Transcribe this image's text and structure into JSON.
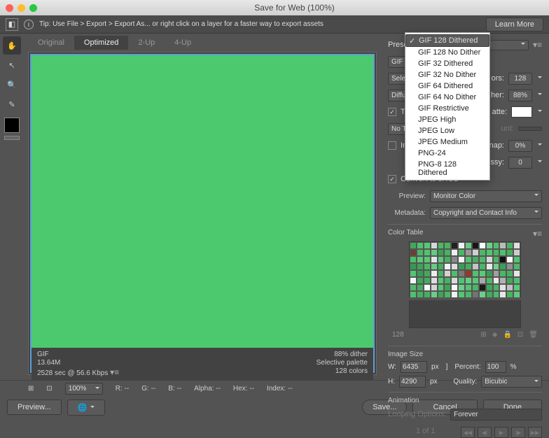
{
  "window": {
    "title": "Save for Web (100%)"
  },
  "tip": {
    "text": "Tip: Use File > Export > Export As...   or right click on a layer for a faster way to export assets",
    "learn": "Learn More"
  },
  "tabs": [
    "Original",
    "Optimized",
    "2-Up",
    "4-Up"
  ],
  "footerLeft": {
    "format": "GIF",
    "size": "13.64M",
    "time": "2528 sec @ 56.6 Kbps"
  },
  "footerRight": {
    "dither": "88% dither",
    "palette": "Selective palette",
    "colors": "128 colors"
  },
  "preset": {
    "label": "Preset"
  },
  "presetMenu": [
    "GIF 128 Dithered",
    "GIF 128 No Dither",
    "GIF 32 Dithered",
    "GIF 32 No Dither",
    "GIF 64 Dithered",
    "GIF 64 No Dither",
    "GIF Restrictive",
    "JPEG High",
    "JPEG Low",
    "JPEG Medium",
    "PNG-24",
    "PNG-8 128 Dithered"
  ],
  "gif": {
    "format": "GIF",
    "selective": "Selec",
    "diffusion": "Diffu",
    "transparency": "Tra",
    "noTrans": "No Tra",
    "interlaced": "Inte",
    "colorsLbl": "ors:",
    "colors": "128",
    "ditherLbl": "her:",
    "dither": "88%",
    "matteLbl": "atte:",
    "amountLbl": "unt:",
    "amount": "",
    "webSnapLbl": "nap:",
    "webSnap": "0%",
    "lossyLbl": "ssy:",
    "lossy": "0"
  },
  "srgb": "Convert to sRGB",
  "previewRow": {
    "label": "Preview:",
    "value": "Monitor Color"
  },
  "metadata": {
    "label": "Metadata:",
    "value": "Copyright and Contact Info"
  },
  "colorTable": {
    "label": "Color Table",
    "count": "128"
  },
  "imageSize": {
    "label": "Image Size",
    "w": "W:",
    "wval": "6435",
    "h": "H:",
    "hval": "4290",
    "px": "px",
    "percentLbl": "Percent:",
    "percent": "100",
    "pct": "%",
    "qualityLbl": "Quality:",
    "quality": "Bicubic"
  },
  "animation": {
    "label": "Animation",
    "loopLbl": "Looping Options:",
    "loop": "Forever",
    "frame": "1 of 1"
  },
  "bottom": {
    "zoom": "100%",
    "r": "R: --",
    "g": "G: --",
    "b": "B: --",
    "alpha": "Alpha: --",
    "hex": "Hex: --",
    "index": "Index: --"
  },
  "actions": {
    "preview": "Preview...",
    "save": "Save...",
    "cancel": "Cancel",
    "done": "Done"
  },
  "ctColors": [
    "#3fa85b",
    "#4ec46e",
    "#57c776",
    "#d8d8d8",
    "#4ab963",
    "#48b560",
    "#222",
    "#f0f0f0",
    "#63cc80",
    "#161616",
    "#fff",
    "#6fce8a",
    "#4cc06c",
    "#bbb",
    "#49b463",
    "#e0e0e0",
    "#6b4034",
    "#4fb46b",
    "#51c270",
    "#65c983",
    "#3c9f56",
    "#47b260",
    "#eee",
    "#48ba64",
    "#999",
    "#d0d0d0",
    "#4fb76b",
    "#52c571",
    "#4cb666",
    "#50c06f",
    "#44ad5e",
    "#ccc",
    "#4dbe6a",
    "#59c878",
    "#5ac777",
    "#e4e4e4",
    "#5ec67d",
    "#46b05f",
    "#888",
    "#f4f4f4",
    "#53c372",
    "#47b162",
    "#4eb86c",
    "#d6d6d6",
    "#4bb565",
    "#111",
    "#fafafa",
    "#54c473",
    "#359a51",
    "#3ca358",
    "#4ab765",
    "#67ca85",
    "#44af5f",
    "#f2f2f2",
    "#dcdcdc",
    "#3b9d55",
    "#45ae5d",
    "#c4c4c4",
    "#49b663",
    "#e8e8e8",
    "#72cf8c",
    "#3aa055",
    "#8f8f8f",
    "#4db76b",
    "#55c575",
    "#369c52",
    "#41aa5c",
    "#ececec",
    "#48b362",
    "#d2d2d2",
    "#4cbf6b",
    "#797979",
    "#963826",
    "#50c16f",
    "#5dc97c",
    "#389d53",
    "#a0a0a0",
    "#4ab864",
    "#46b160",
    "#e6e6e6",
    "#f6f6f6",
    "#3fa559",
    "#43ac5d",
    "#dedede",
    "#56c676",
    "#47b261",
    "#dadada",
    "#52c271",
    "#69cb86",
    "#59c778",
    "#a9a9a9",
    "#4bb966",
    "#eaeaea",
    "#b2b2b2",
    "#41a85a",
    "#51bf70",
    "#4eb96c",
    "#44ad5d",
    "#fdfdfd",
    "#d4d4d4",
    "#58c677",
    "#3da256",
    "#f8f8f8",
    "#6bcd88",
    "#53c373",
    "#4ab562",
    "#1a1a1a",
    "#40a758",
    "#49b464",
    "#e2e2e2",
    "#c0c0c0",
    "#5bc879",
    "#4fc06d",
    "#45af5e",
    "#46b05e",
    "#6dcc89",
    "#3ea457",
    "#49b763",
    "#f1f1f1",
    "#54c574",
    "#4cb868",
    "#737373",
    "#70ce8b",
    "#42aa5c",
    "#4db96a",
    "#e7e7e7",
    "#48b261",
    "#60ca7f"
  ]
}
